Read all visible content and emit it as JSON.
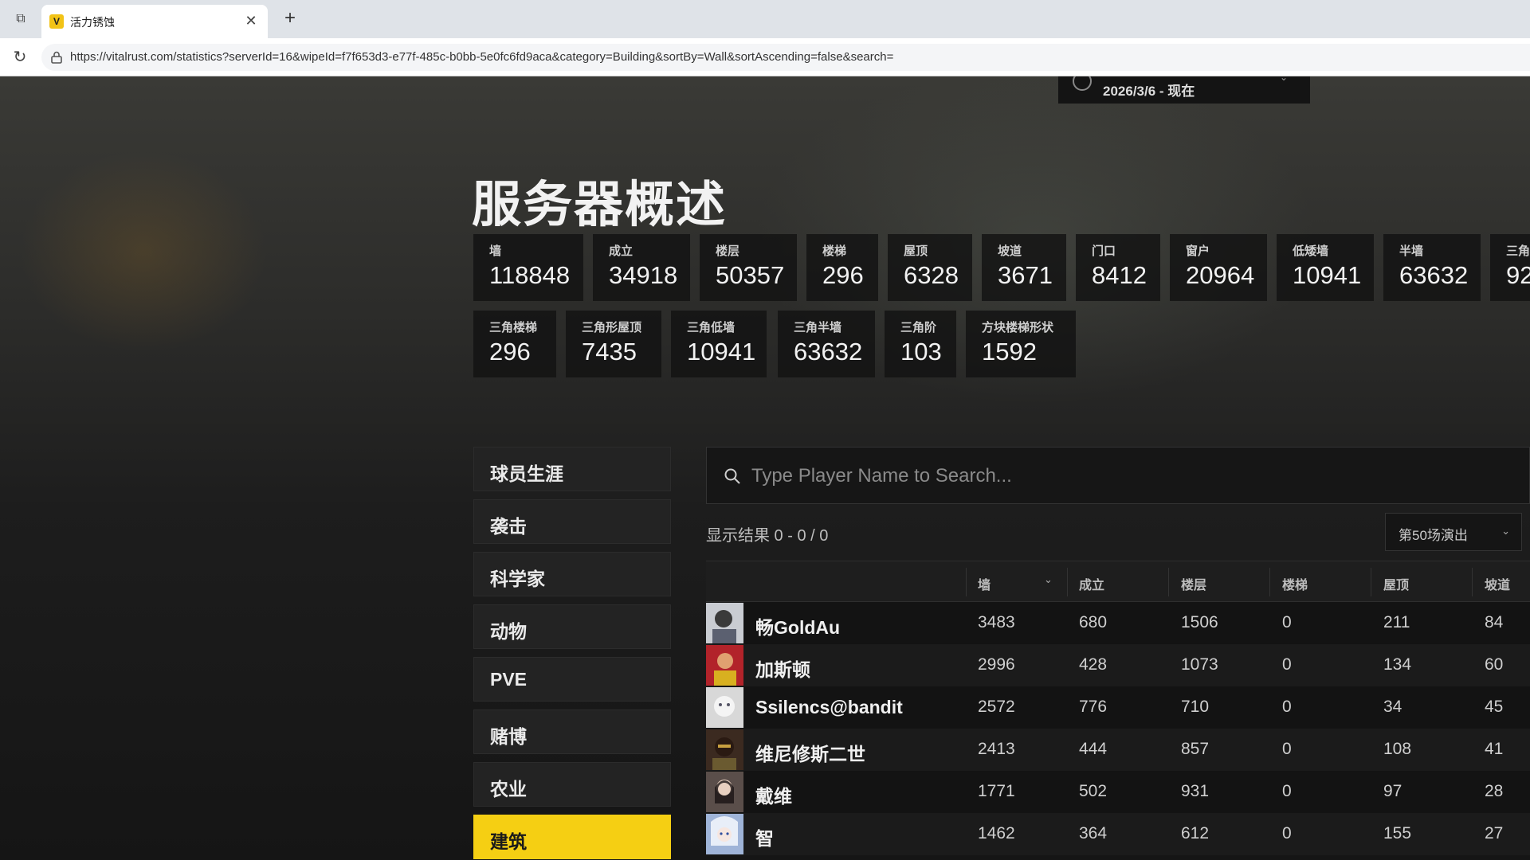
{
  "browser": {
    "tab_title": "活力锈蚀",
    "favicon_glyph": "V",
    "close_glyph": "✕",
    "new_tab_glyph": "+",
    "reload_glyph": "↻",
    "collections_glyph": "⧉",
    "url": "https://vitalrust.com/statistics?serverId=16&wipeId=f7f653d3-e77f-485c-b0bb-5e0fc6fd9aca&category=Building&sortBy=Wall&sortAscending=false&search="
  },
  "date_range": {
    "label": "2026/3/6 - 现在",
    "chevron": "⌄"
  },
  "page_title": "服务器概述",
  "stats_row1": [
    {
      "label": "墙",
      "value": "118848"
    },
    {
      "label": "成立",
      "value": "34918"
    },
    {
      "label": "楼层",
      "value": "50357"
    },
    {
      "label": "楼梯",
      "value": "296"
    },
    {
      "label": "屋顶",
      "value": "6328"
    },
    {
      "label": "坡道",
      "value": "3671"
    },
    {
      "label": "门口",
      "value": "8412"
    },
    {
      "label": "窗户",
      "value": "20964"
    },
    {
      "label": "低矮墙",
      "value": "10941"
    },
    {
      "label": "半墙",
      "value": "63632"
    },
    {
      "label": "三角",
      "value": "92"
    }
  ],
  "stats_row2": [
    {
      "label": "三角楼梯",
      "value": "296"
    },
    {
      "label": "三角形屋顶",
      "value": "7435"
    },
    {
      "label": "三角低墙",
      "value": "10941"
    },
    {
      "label": "三角半墙",
      "value": "63632"
    },
    {
      "label": "三角阶",
      "value": "103"
    },
    {
      "label": "方块楼梯形状",
      "value": "1592"
    }
  ],
  "sidebar": {
    "items": [
      {
        "label": "球员生涯"
      },
      {
        "label": "袭击"
      },
      {
        "label": "科学家"
      },
      {
        "label": "动物"
      },
      {
        "label": "PVE"
      },
      {
        "label": "赌博"
      },
      {
        "label": "农业"
      },
      {
        "label": "建筑",
        "active": true
      }
    ]
  },
  "search": {
    "placeholder": "Type Player Name to Search..."
  },
  "results_text": "显示结果 0 - 0 / 0",
  "wipe_select": {
    "label": "第50场演出",
    "chevron": "⌄"
  },
  "table": {
    "sort_chevron": "⌄",
    "columns": [
      "墙",
      "成立",
      "楼层",
      "楼梯",
      "屋顶",
      "坡道"
    ],
    "rows": [
      {
        "name": "畅GoldAu",
        "values": [
          "3483",
          "680",
          "1506",
          "0",
          "211",
          "84"
        ]
      },
      {
        "name": "加斯顿",
        "values": [
          "2996",
          "428",
          "1073",
          "0",
          "134",
          "60"
        ]
      },
      {
        "name": "Ssilencs@bandit",
        "values": [
          "2572",
          "776",
          "710",
          "0",
          "34",
          "45"
        ]
      },
      {
        "name": "维尼修斯二世",
        "values": [
          "2413",
          "444",
          "857",
          "0",
          "108",
          "41"
        ]
      },
      {
        "name": "戴维",
        "values": [
          "1771",
          "502",
          "931",
          "0",
          "97",
          "28"
        ]
      },
      {
        "name": "智",
        "values": [
          "1462",
          "364",
          "612",
          "0",
          "155",
          "27"
        ]
      }
    ]
  },
  "colors": {
    "accent": "#f5cf13",
    "avatar_fills": [
      "#c9ccd2",
      "#b2232a",
      "#d8d8d8",
      "#3b2a20",
      "#5a4e4a",
      "#9fb4d8"
    ]
  }
}
